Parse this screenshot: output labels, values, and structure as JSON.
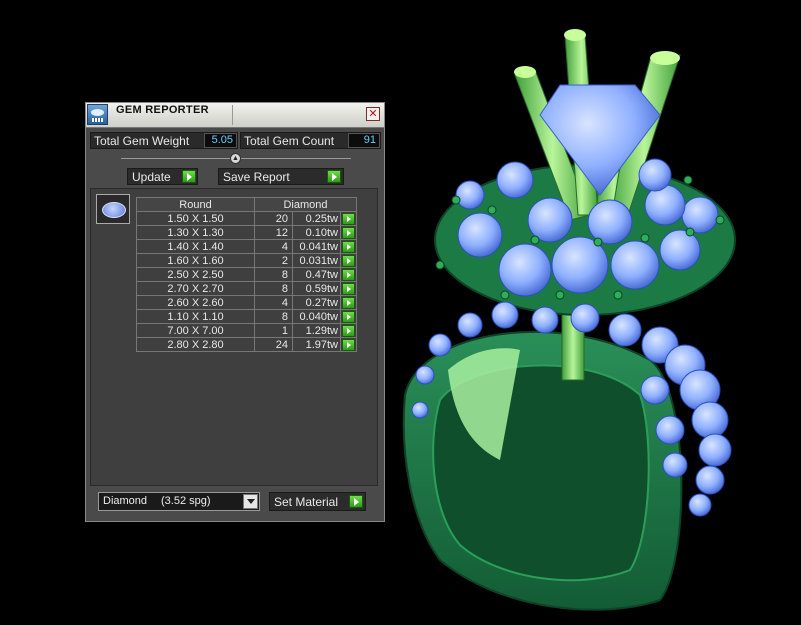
{
  "window": {
    "title": "GEM REPORTER",
    "close_glyph": "✕"
  },
  "stats": {
    "total_weight_label": "Total Gem Weight",
    "total_weight_value": "5.05",
    "total_count_label": "Total Gem Count",
    "total_count_value": "91"
  },
  "slider": {
    "knob_glyph": "▲"
  },
  "buttons": {
    "update": "Update",
    "save_report": "Save Report",
    "set_material": "Set Material"
  },
  "table": {
    "headers": [
      "Round",
      "Diamond"
    ],
    "rows": [
      {
        "size": "1.50 X 1.50",
        "count": "20",
        "weight": "0.25tw"
      },
      {
        "size": "1.30 X 1.30",
        "count": "12",
        "weight": "0.10tw"
      },
      {
        "size": "1.40 X 1.40",
        "count": "4",
        "weight": "0.041tw"
      },
      {
        "size": "1.60 X 1.60",
        "count": "2",
        "weight": "0.031tw"
      },
      {
        "size": "2.50 X 2.50",
        "count": "8",
        "weight": "0.47tw"
      },
      {
        "size": "2.70 X 2.70",
        "count": "8",
        "weight": "0.59tw"
      },
      {
        "size": "2.60 X 2.60",
        "count": "4",
        "weight": "0.27tw"
      },
      {
        "size": "1.10 X 1.10",
        "count": "8",
        "weight": "0.040tw"
      },
      {
        "size": "7.00 X 7.00",
        "count": "1",
        "weight": "1.29tw"
      },
      {
        "size": "2.80 X 2.80",
        "count": "24",
        "weight": "1.97tw"
      }
    ]
  },
  "material": {
    "name": "Diamond",
    "spg": "(3.52 spg)"
  },
  "colors": {
    "metal": "#1f7a4a",
    "gem": "#8fb0ff",
    "accent_value": "#66d0ff",
    "go_button": "#3cb82a"
  },
  "icons": [
    "gem-reporter-app-icon",
    "close-icon",
    "slider-knob-icon",
    "green-arrow-icon",
    "dropdown-arrow-icon",
    "round-gem-icon"
  ]
}
